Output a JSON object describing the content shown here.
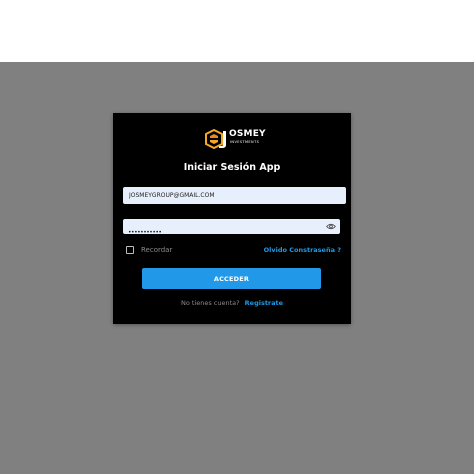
{
  "logo": {
    "brand": "OSMEY",
    "subtitle": "INVESTMENTS",
    "colors": {
      "primary": "#f5a623",
      "secondary": "#e8871e"
    }
  },
  "login": {
    "title": "Iniciar Sesión App",
    "email_value": "JOSMEYGROUP@GMAIL.COM",
    "password_mask": "•••••••••••",
    "remember_label": "Recordar",
    "forgot_label": "Olvido Constraseña ?",
    "submit_label": "ACCEDER",
    "no_account_text": "No tienes cuenta?",
    "register_label": "Registrate"
  },
  "colors": {
    "overlay": "#808080",
    "card": "#000000",
    "accent": "#2199e8",
    "input_bg": "#e8effc"
  }
}
